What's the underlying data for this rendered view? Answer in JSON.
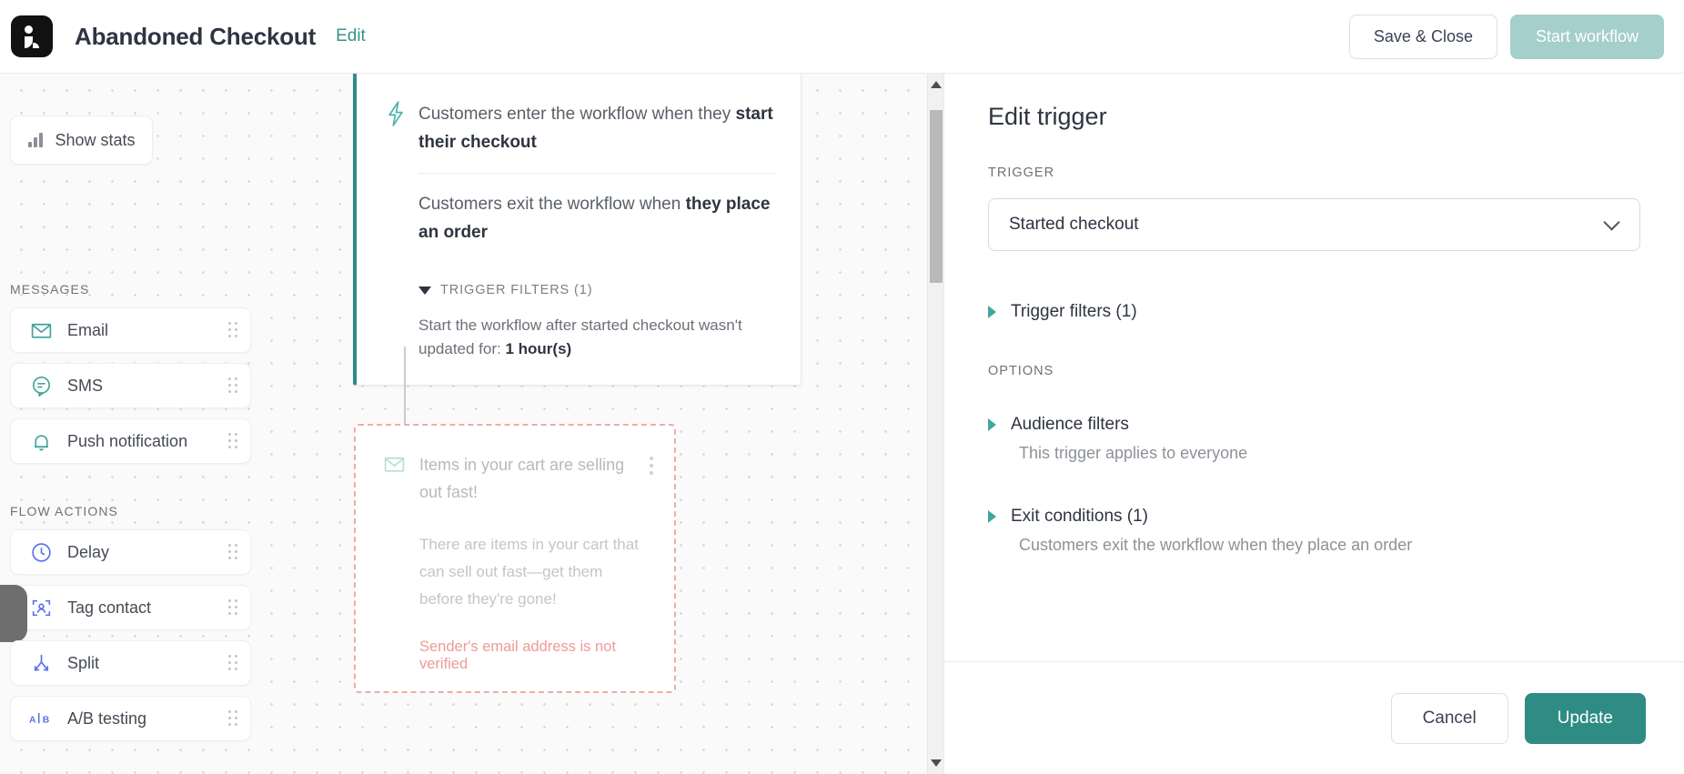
{
  "colors": {
    "teal": "#2f8c84",
    "teal_muted": "#a4cfca",
    "teal_arrow": "#3fa89e",
    "error_pink": "#ef9a97",
    "flow_blue": "#4f6ef7",
    "canvas_bg": "#fafafa"
  },
  "topbar": {
    "logo_name": "app-logo",
    "workflow_title": "Abandoned Checkout",
    "edit_label": "Edit",
    "save_close_label": "Save & Close",
    "start_workflow_label": "Start workflow"
  },
  "palette": {
    "show_stats_label": "Show stats",
    "messages_label": "MESSAGES",
    "flow_actions_label": "FLOW ACTIONS",
    "messages": [
      {
        "label": "Email",
        "icon": "envelope-icon"
      },
      {
        "label": "SMS",
        "icon": "chat-bubble-icon"
      },
      {
        "label": "Push notification",
        "icon": "bell-icon"
      }
    ],
    "flow_actions": [
      {
        "label": "Delay",
        "icon": "clock-icon"
      },
      {
        "label": "Tag contact",
        "icon": "tag-contact-icon"
      },
      {
        "label": "Split",
        "icon": "split-icon"
      },
      {
        "label": "A/B testing",
        "icon": "ab-test-icon"
      }
    ]
  },
  "canvas": {
    "trigger_node": {
      "icon": "lightning-bolt-icon",
      "enter_text_prefix": "Customers enter the workflow when they ",
      "enter_text_bold": "start their checkout",
      "exit_text_prefix": "Customers exit the workflow when ",
      "exit_text_bold": "they place an order",
      "filters_header": "TRIGGER FILTERS (1)",
      "filter_text_prefix": "Start the workflow after started checkout wasn't updated for: ",
      "filter_text_bold": "1 hour(s)"
    },
    "email_node": {
      "icon": "envelope-icon",
      "subject": "Items in your cart are selling out fast!",
      "preview": "There are items in your cart that can sell out fast—get them before they're gone!",
      "error": "Sender's email address is not verified"
    }
  },
  "panel": {
    "title": "Edit trigger",
    "trigger_label": "TRIGGER",
    "trigger_value": "Started checkout",
    "trigger_filters_label": "Trigger filters (1)",
    "options_label": "OPTIONS",
    "audience_filters_label": "Audience filters",
    "audience_filters_desc": "This trigger applies to everyone",
    "exit_conditions_label": "Exit conditions (1)",
    "exit_conditions_desc": "Customers exit the workflow when they place an order",
    "cancel_label": "Cancel",
    "update_label": "Update"
  }
}
